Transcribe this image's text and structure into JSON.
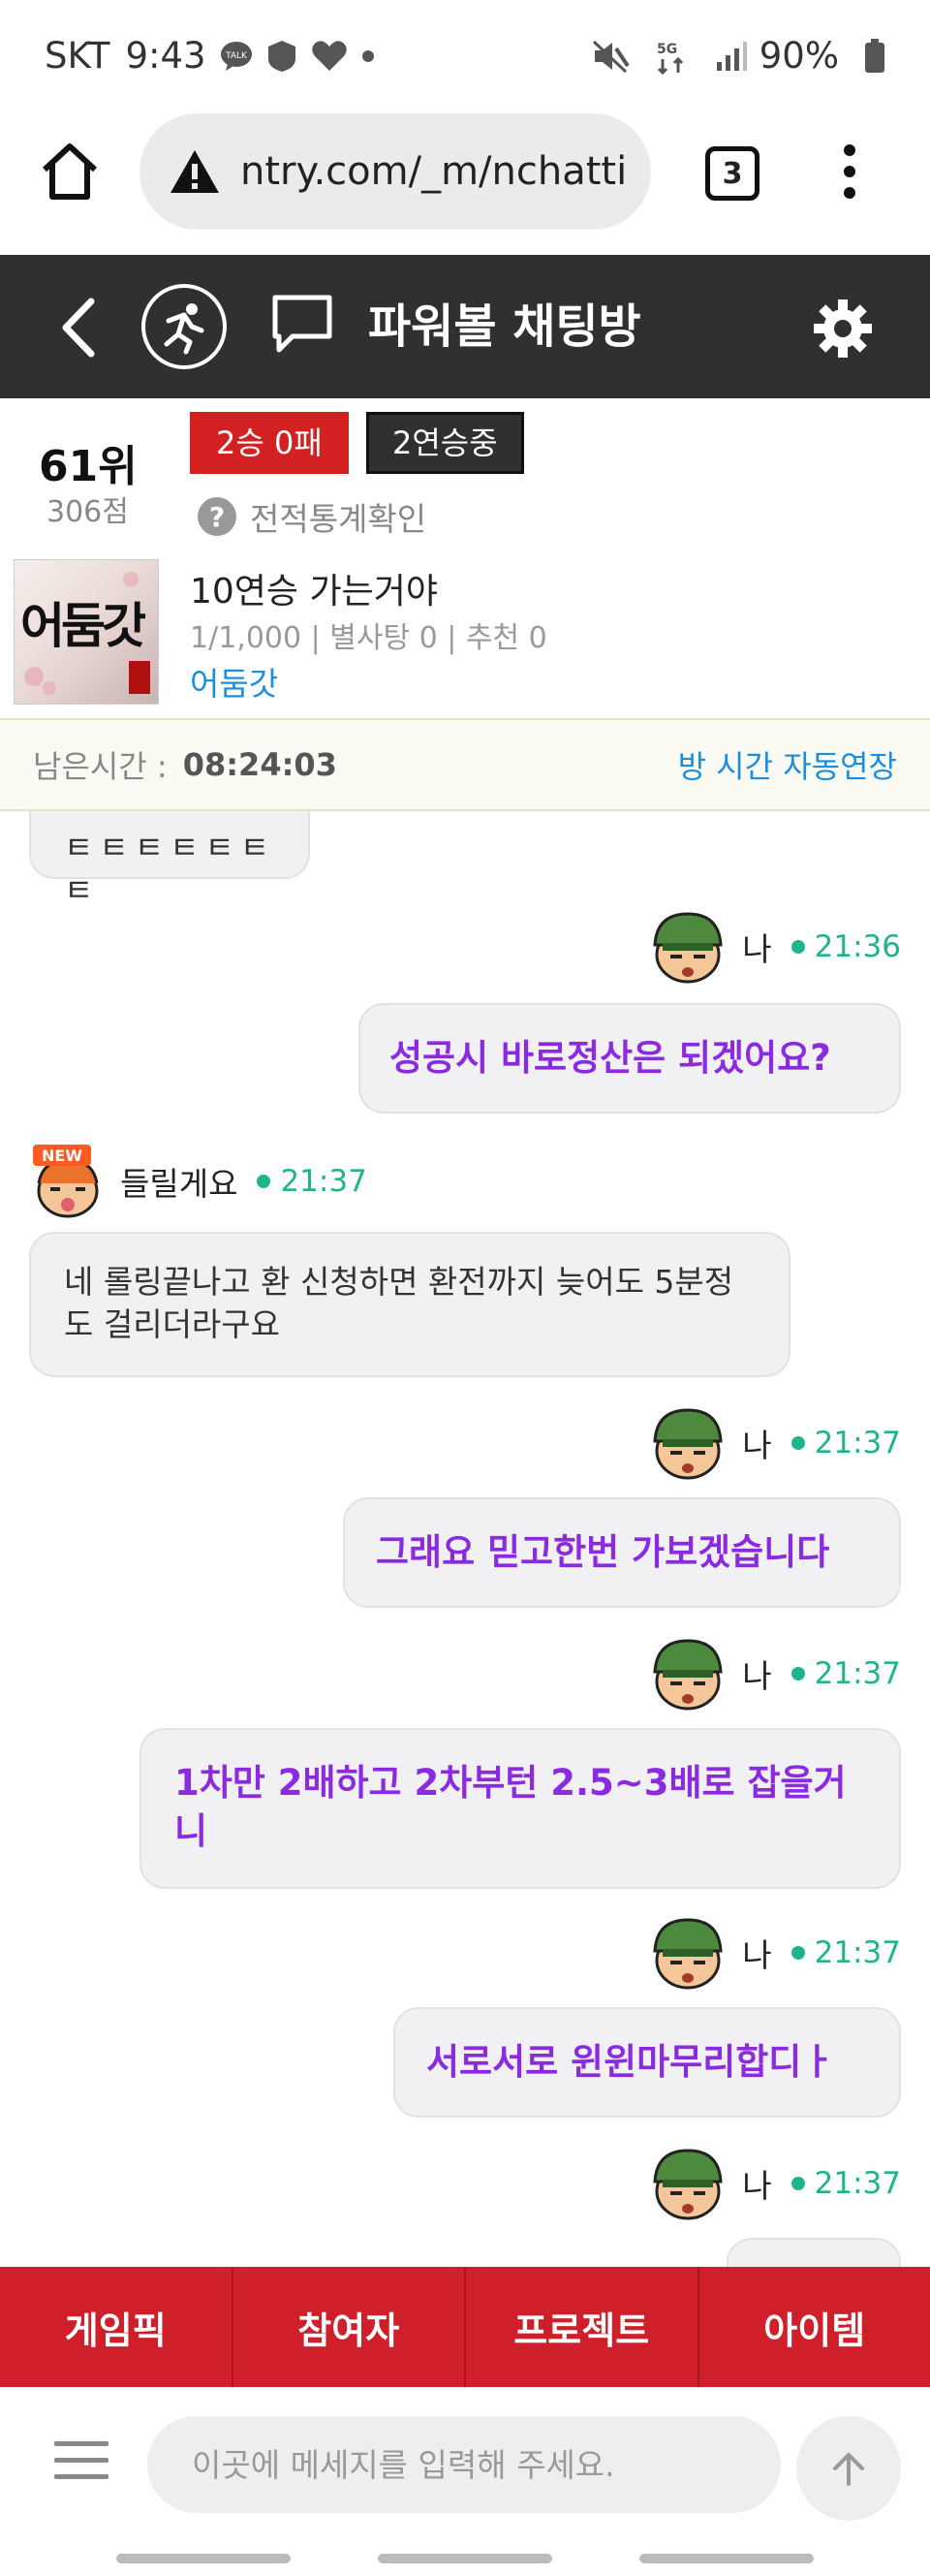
{
  "status_bar": {
    "carrier": "SKT",
    "time": "9:43",
    "battery": "90%"
  },
  "browser": {
    "url": "ntry.com/_m/nchatti",
    "tab_count": "3"
  },
  "app_header": {
    "title": "파워볼 채팅방"
  },
  "profile": {
    "rank": "61위",
    "points": "306점",
    "record_badge": "2승 0패",
    "streak_badge": "2연승중",
    "stats_link": "전적통계확인",
    "avatar_text": "어둠갓",
    "status_message": "10연승 가는거야",
    "meta": "1/1,000 | 별사탕 0 | 추천 0",
    "nickname": "어둠갓"
  },
  "timer": {
    "label": "남은시간 :",
    "value": "08:24:03",
    "extend_label": "방 시간 자동연장"
  },
  "messages": [
    {
      "sender": "",
      "time": "",
      "text": "ㅌㅌㅌㅌㅌㅌㅌ",
      "mine": false
    },
    {
      "sender": "나",
      "time": "21:36",
      "text": "성공시 바로정산은 되겠어요?",
      "mine": true
    },
    {
      "sender": "들릴게요",
      "time": "21:37",
      "text": "네 롤링끝나고 환 신청하면 환전까지 늦어도 5분정도 걸리더라구요",
      "mine": false
    },
    {
      "sender": "나",
      "time": "21:37",
      "text": "그래요 믿고한번 가보겠습니다",
      "mine": true
    },
    {
      "sender": "나",
      "time": "21:37",
      "text": "1차만 2배하고 2차부턴 2.5~3배로 잡을거니",
      "mine": true
    },
    {
      "sender": "나",
      "time": "21:37",
      "text": "서로서로 윈윈마무리합디ㅏ",
      "mine": true
    },
    {
      "sender": "나",
      "time": "21:37",
      "text": "",
      "mine": true
    }
  ],
  "tabs": [
    "게임픽",
    "참여자",
    "프로젝트",
    "아이템"
  ],
  "input": {
    "placeholder": "이곳에 메세지를 입력해 주세요."
  },
  "colors": {
    "header_bg": "#303030",
    "tabbar_bg": "#cf1f2b",
    "my_message": "#8a2be2",
    "online": "#1fb58a",
    "link": "#1a8fe0"
  }
}
